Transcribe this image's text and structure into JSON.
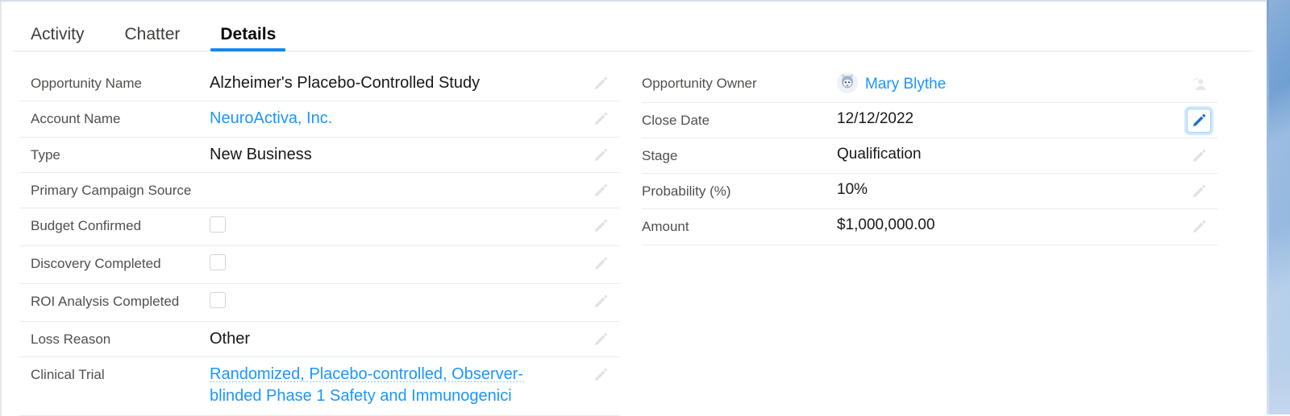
{
  "tabs": [
    {
      "label": "Activity",
      "active": false
    },
    {
      "label": "Chatter",
      "active": false
    },
    {
      "label": "Details",
      "active": true
    }
  ],
  "colors": {
    "accent": "#1589ee",
    "link": "#1b96ff",
    "label": "#514f4d",
    "value": "#181818",
    "divider": "#ebebeb",
    "focus_ring": "#9fd2ff",
    "pencil": "#e3e3e3",
    "pencil_active": "#1d6fd0"
  },
  "left_column": {
    "fields": [
      {
        "label": "Opportunity Name",
        "value": "Alzheimer's Placebo-Controlled Study",
        "type": "text",
        "action_icon": "pencil-icon",
        "action_focused": false
      },
      {
        "label": "Account Name",
        "value": "NeuroActiva, Inc.",
        "type": "link",
        "action_icon": "pencil-icon",
        "action_focused": false
      },
      {
        "label": "Type",
        "value": "New Business",
        "type": "text",
        "action_icon": "pencil-icon",
        "action_focused": false
      },
      {
        "label": "Primary Campaign Source",
        "value": "",
        "type": "text",
        "action_icon": "pencil-icon",
        "action_focused": false
      },
      {
        "label": "Budget Confirmed",
        "value": "",
        "type": "checkbox",
        "checked": false,
        "action_icon": "pencil-icon",
        "action_focused": false
      },
      {
        "label": "Discovery Completed",
        "value": "",
        "type": "checkbox",
        "checked": false,
        "action_icon": "pencil-icon",
        "action_focused": false
      },
      {
        "label": "ROI Analysis Completed",
        "value": "",
        "type": "checkbox",
        "checked": false,
        "action_icon": "pencil-icon",
        "action_focused": false
      },
      {
        "label": "Loss Reason",
        "value": "Other",
        "type": "text",
        "action_icon": "pencil-icon",
        "action_focused": false
      },
      {
        "label": "Clinical Trial",
        "value": "Randomized, Placebo-controlled, Observer-blinded Phase 1 Safety and Immunogenici",
        "type": "link-dotted",
        "action_icon": "pencil-icon",
        "action_focused": false
      }
    ]
  },
  "right_column": {
    "fields": [
      {
        "label": "Opportunity Owner",
        "value": "Mary Blythe",
        "type": "owner-link",
        "avatar": "astro-avatar",
        "action_icon": "change-owner-icon",
        "action_focused": false
      },
      {
        "label": "Close Date",
        "value": "12/12/2022",
        "type": "text",
        "action_icon": "pencil-icon",
        "action_focused": true
      },
      {
        "label": "Stage",
        "value": "Qualification",
        "type": "text",
        "action_icon": "pencil-icon",
        "action_focused": false
      },
      {
        "label": "Probability (%)",
        "value": "10%",
        "type": "text",
        "action_icon": "pencil-icon",
        "action_focused": false
      },
      {
        "label": "Amount",
        "value": "$1,000,000.00",
        "type": "text",
        "action_icon": "pencil-icon",
        "action_focused": false
      }
    ]
  }
}
